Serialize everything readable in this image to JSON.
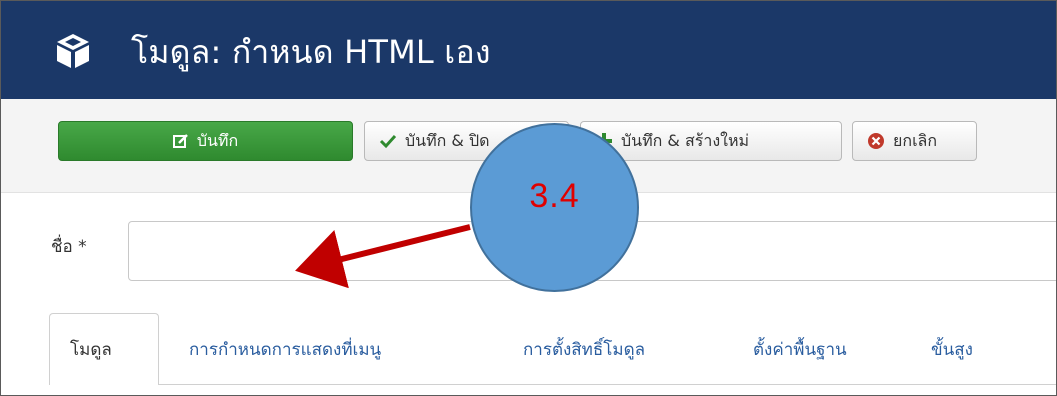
{
  "header": {
    "title": "โมดูล: กำหนด HTML เอง",
    "icon": "cube-icon"
  },
  "toolbar": {
    "save_label": "บันทึก",
    "save_close_label": "บันทึก & ปิด",
    "save_new_label": "บันทึก & สร้างใหม่",
    "cancel_label": "ยกเลิก"
  },
  "form": {
    "name_label": "ชื่อ *",
    "name_value": ""
  },
  "tabs": [
    {
      "label": "โมดูล"
    },
    {
      "label": "การกำหนดการแสดงที่เมนู"
    },
    {
      "label": "การตั้งสิทธิ์โมดูล"
    },
    {
      "label": "ตั้งค่าพื้นฐาน"
    },
    {
      "label": "ขั้นสูง"
    }
  ],
  "annotation": {
    "label": "3.4",
    "circle_color": "#5b9bd5",
    "arrow_color": "#c00000"
  },
  "colors": {
    "header_bg": "#1b3868",
    "save_button": "#3a9a3a",
    "cancel_icon": "#c0392b"
  }
}
